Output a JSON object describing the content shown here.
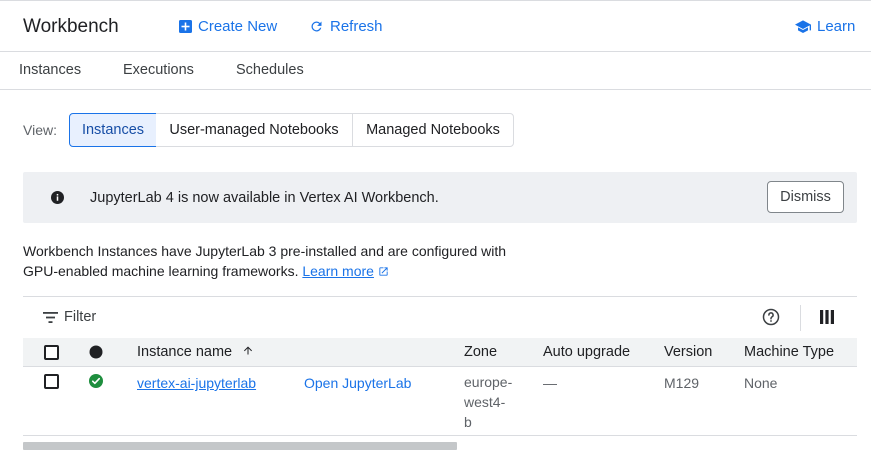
{
  "header": {
    "title": "Workbench",
    "create_new": "Create New",
    "refresh": "Refresh",
    "learn": "Learn"
  },
  "tabs": [
    "Instances",
    "Executions",
    "Schedules"
  ],
  "view": {
    "label": "View:",
    "options": [
      "Instances",
      "User-managed Notebooks",
      "Managed Notebooks"
    ],
    "selected": "Instances"
  },
  "banner": {
    "icon": "info-icon",
    "text": "JupyterLab 4 is now available in Vertex AI Workbench.",
    "dismiss": "Dismiss"
  },
  "description": {
    "line1": "Workbench Instances have JupyterLab 3 pre-installed and are configured with",
    "line2": "GPU-enabled machine learning frameworks.",
    "link": "Learn more"
  },
  "toolbar": {
    "filter": "Filter"
  },
  "table": {
    "columns": {
      "name": "Instance name",
      "zone": "Zone",
      "auto_upgrade": "Auto upgrade",
      "version": "Version",
      "machine_type": "Machine Type"
    },
    "sort": "ascending",
    "rows": [
      {
        "status": "running",
        "name": "vertex-ai-jupyterlab",
        "action": "Open JupyterLab",
        "zone_lines": [
          "europe-",
          "west4-",
          "b"
        ],
        "auto_upgrade": "—",
        "version": "M129",
        "machine_type": "None"
      }
    ]
  },
  "colors": {
    "accent": "#1a73e8",
    "status_ok": "#1e8e3e",
    "banner_bg": "#eef0f3"
  }
}
